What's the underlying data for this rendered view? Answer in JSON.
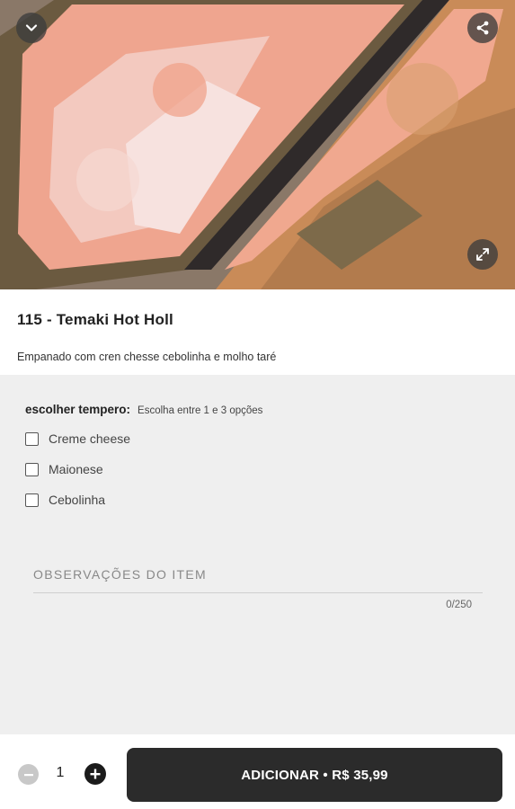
{
  "header": {
    "back_icon": "chevron-down-icon",
    "share_icon": "share-icon",
    "expand_icon": "expand-icon"
  },
  "product": {
    "title": "115 - Temaki Hot Holl",
    "description": "Empanado com cren chesse cebolinha e molho taré"
  },
  "options_group": {
    "title": "escolher tempero:",
    "hint": "Escolha entre 1 e 3 opções",
    "options": [
      {
        "label": "Creme cheese",
        "checked": false
      },
      {
        "label": "Maionese",
        "checked": false
      },
      {
        "label": "Cebolinha",
        "checked": false
      }
    ]
  },
  "notes": {
    "placeholder": "OBSERVAÇÕES DO ITEM",
    "value": "",
    "counter": "0/250"
  },
  "footer": {
    "quantity": "1",
    "add_button_label": "ADICIONAR • R$ 35,99"
  },
  "colors": {
    "button_dark": "#2b2b2b",
    "background": "#efefef"
  }
}
